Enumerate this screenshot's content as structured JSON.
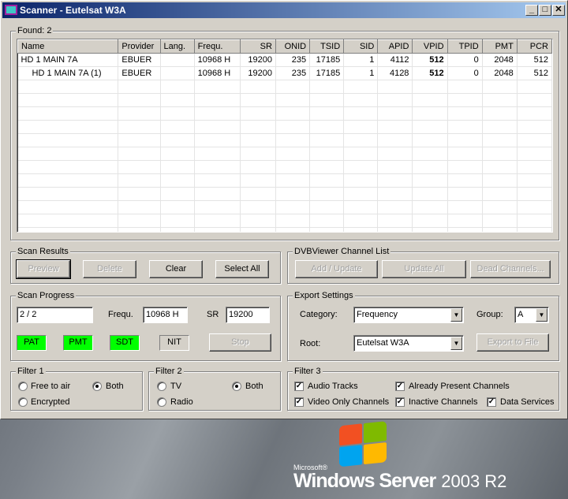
{
  "window": {
    "title": "Scanner - Eutelsat W3A",
    "min": "_",
    "max": "□",
    "close": "✕"
  },
  "found": {
    "label": "Found:",
    "count": "2"
  },
  "table": {
    "headers": [
      "Name",
      "Provider",
      "Lang.",
      "Frequ.",
      "SR",
      "ONID",
      "TSID",
      "SID",
      "APID",
      "VPID",
      "TPID",
      "PMT",
      "PCR"
    ],
    "rows": [
      [
        "HD 1 MAIN 7A",
        "EBUER",
        "",
        "10968 H",
        "19200",
        "235",
        "17185",
        "1",
        "4112",
        "512",
        "0",
        "2048",
        "512"
      ],
      [
        "HD 1 MAIN 7A (1)",
        "EBUER",
        "",
        "10968 H",
        "19200",
        "235",
        "17185",
        "1",
        "4128",
        "512",
        "0",
        "2048",
        "512"
      ]
    ]
  },
  "scan_results": {
    "label": "Scan Results",
    "preview": "Preview",
    "delete": "Delete",
    "clear": "Clear",
    "select_all": "Select All"
  },
  "dvbviewer": {
    "label": "DVBViewer Channel List",
    "add_update": "Add / Update",
    "update_all": "Update All",
    "dead_channels": "Dead Channels..."
  },
  "scan_progress": {
    "label": "Scan Progress",
    "progress": "2 / 2",
    "frequ_label": "Frequ.",
    "frequ": "10968 H",
    "sr_label": "SR",
    "sr": "19200",
    "pat": "PAT",
    "pmt": "PMT",
    "sdt": "SDT",
    "nit": "NIT",
    "stop": "Stop"
  },
  "export": {
    "label": "Export Settings",
    "category_label": "Category:",
    "category": "Frequency",
    "group_label": "Group:",
    "group": "A",
    "root_label": "Root:",
    "root": "Eutelsat W3A",
    "export_btn": "Export to File"
  },
  "filter1": {
    "label": "Filter 1",
    "free_to_air": "Free to air",
    "both": "Both",
    "encrypted": "Encrypted",
    "selected": "Both"
  },
  "filter2": {
    "label": "Filter 2",
    "tv": "TV",
    "both": "Both",
    "radio": "Radio",
    "selected": "Both"
  },
  "filter3": {
    "label": "Filter 3",
    "audio": "Audio Tracks",
    "already": "Already Present Channels",
    "video_only": "Video Only Channels",
    "inactive": "Inactive Channels",
    "data": "Data Services",
    "checked": [
      "Audio Tracks",
      "Already Present Channels",
      "Video Only Channels",
      "Inactive Channels",
      "Data Services"
    ]
  },
  "branding": {
    "microsoft": "Microsoft®",
    "product": "Windows Server",
    "version": "2003 R2"
  },
  "colors": {
    "indicator_on": "#00ff00",
    "title_start": "#0a246a",
    "title_end": "#a6caf0"
  }
}
